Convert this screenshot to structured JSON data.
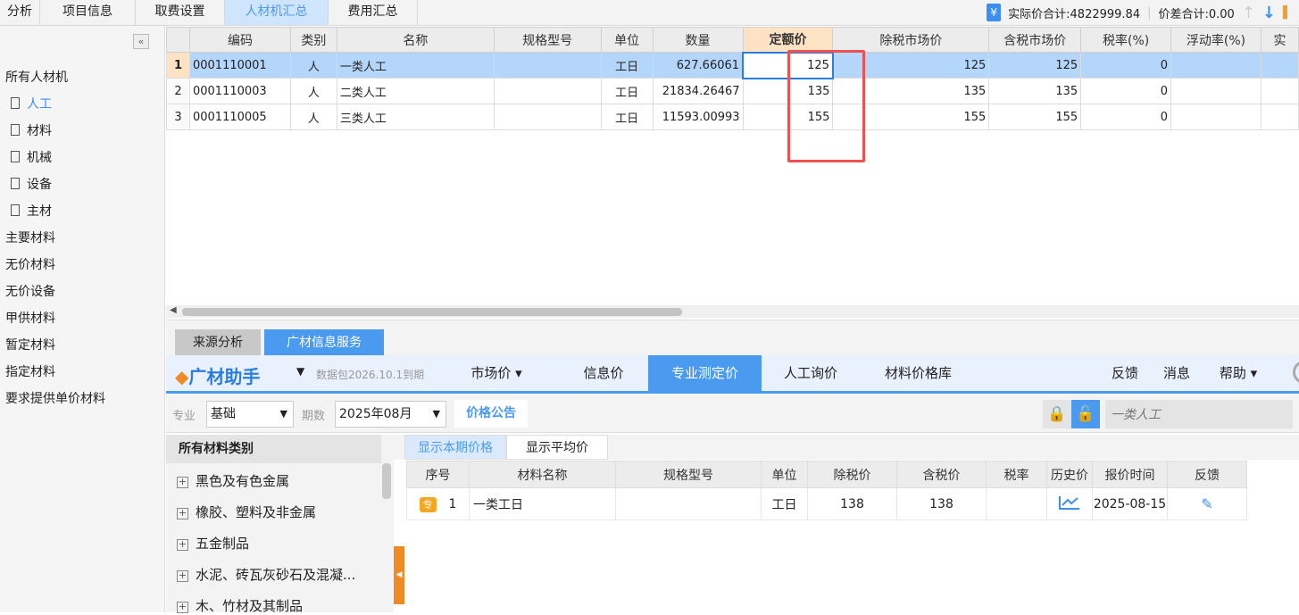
{
  "top_tabs": [
    "分析",
    "项目信息",
    "取费设置",
    "人材机汇总",
    "费用汇总"
  ],
  "active_top_tab": "人材机汇总",
  "summary": {
    "actual_total": "实际价合计:4822999.84",
    "diff_total": "价差合计:0.00"
  },
  "tree": {
    "root": "所有人材机",
    "children": [
      "人工",
      "材料",
      "机械",
      "设备",
      "主材"
    ],
    "others": [
      "主要材料",
      "无价材料",
      "无价设备",
      "甲供材料",
      "暂定材料",
      "指定材料",
      "要求提供单价材料"
    ]
  },
  "grid": {
    "columns": [
      "编码",
      "类别",
      "名称",
      "规格型号",
      "单位",
      "数量",
      "定额价",
      "除税市场价",
      "含税市场价",
      "税率(%)",
      "浮动率(%)",
      "实"
    ],
    "rows": [
      {
        "no": "1",
        "code": "0001110001",
        "type": "人",
        "name": "一类人工",
        "spec": "",
        "unit": "工日",
        "qty": "627.66061",
        "quota": "125",
        "ex_tax": "125",
        "in_tax": "125",
        "tax": "0",
        "float": ""
      },
      {
        "no": "2",
        "code": "0001110003",
        "type": "人",
        "name": "二类人工",
        "spec": "",
        "unit": "工日",
        "qty": "21834.26467",
        "quota": "135",
        "ex_tax": "135",
        "in_tax": "135",
        "tax": "0",
        "float": ""
      },
      {
        "no": "3",
        "code": "0001110005",
        "type": "人",
        "name": "三类人工",
        "spec": "",
        "unit": "工日",
        "qty": "11593.00993",
        "quota": "155",
        "ex_tax": "155",
        "in_tax": "155",
        "tax": "0",
        "float": ""
      }
    ]
  },
  "bottom_tabs": [
    "来源分析",
    "广材信息服务"
  ],
  "assistant": {
    "logo": "广材助手",
    "package": "数据包2026.10.1到期",
    "nav": [
      "市场价 ▾",
      "信息价",
      "专业测定价",
      "人工询价",
      "材料价格库"
    ],
    "active": "专业测定价",
    "links": [
      "反馈",
      "消息",
      "帮助 ▾"
    ]
  },
  "filter": {
    "major_label": "专业",
    "major_value": "基础",
    "period_label": "期数",
    "period_value": "2025年08月",
    "notice": "价格公告",
    "search_placeholder": "一类人工"
  },
  "categories": {
    "title": "所有材料类别",
    "items": [
      "黑色及有色金属",
      "橡胶、塑料及非金属",
      "五金制品",
      "水泥、砖瓦灰砂石及混凝...",
      "木、竹材及其制品"
    ]
  },
  "price_tabs": [
    "显示本期价格",
    "显示平均价"
  ],
  "price_table": {
    "columns": [
      "序号",
      "材料名称",
      "规格型号",
      "单位",
      "除税价",
      "含税价",
      "税率",
      "历史价",
      "报价时间",
      "反馈"
    ],
    "rows": [
      {
        "badge": "专",
        "no": "1",
        "name": "一类工日",
        "spec": "",
        "unit": "工日",
        "ex_tax": "138",
        "in_tax": "138",
        "tax": "",
        "date": "2025-08-15"
      }
    ]
  }
}
